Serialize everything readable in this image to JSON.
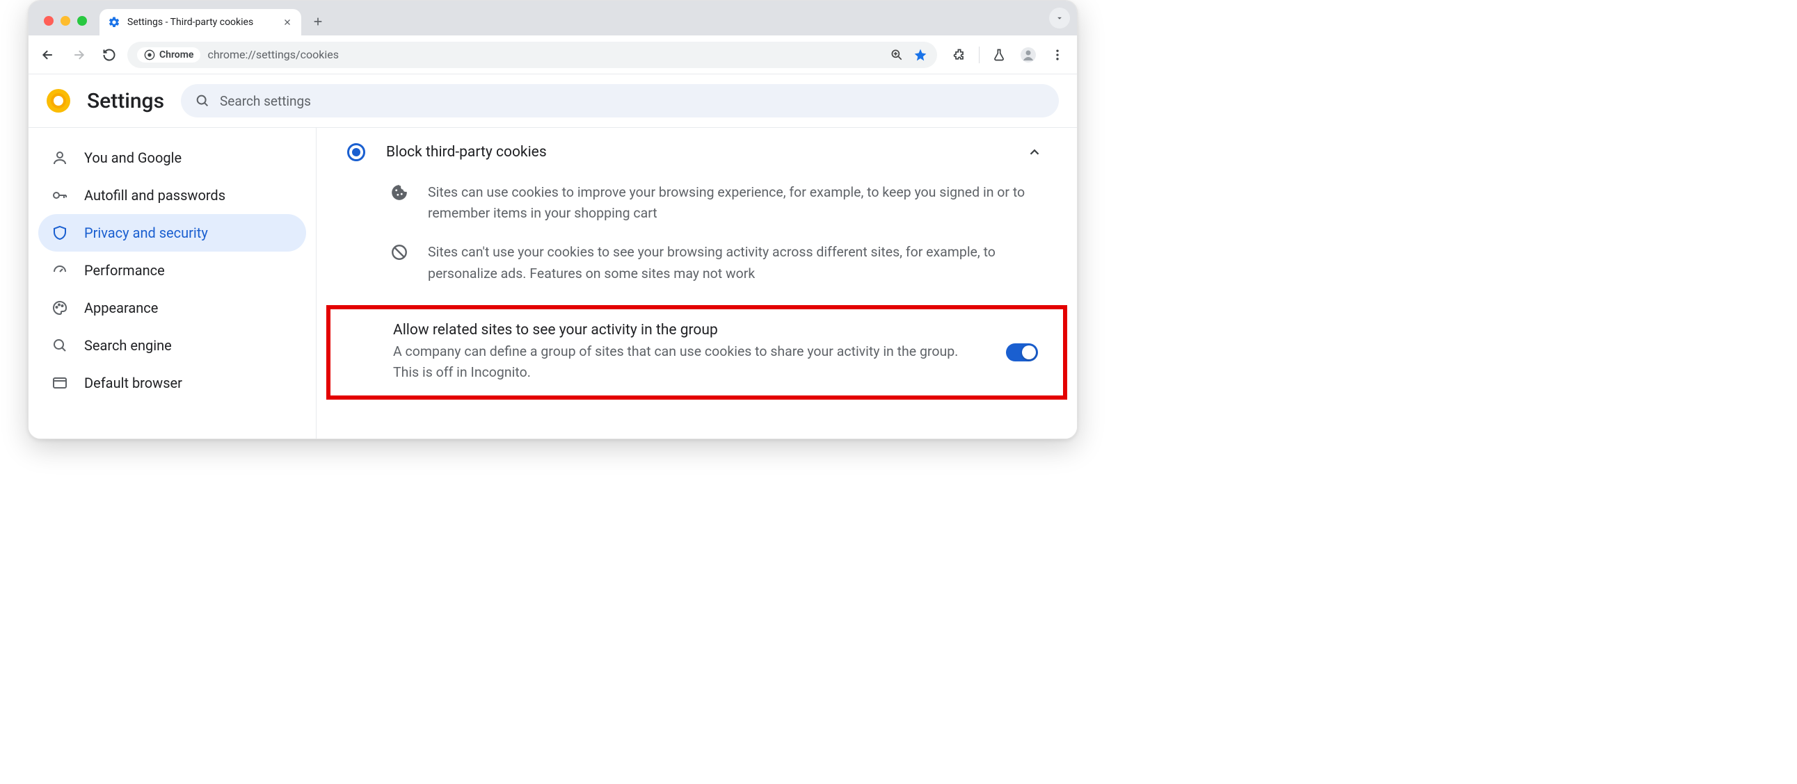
{
  "tab": {
    "title": "Settings - Third-party cookies"
  },
  "omnibox": {
    "chip_label": "Chrome",
    "url": "chrome://settings/cookies"
  },
  "header": {
    "title": "Settings"
  },
  "search": {
    "placeholder": "Search settings"
  },
  "sidebar": {
    "items": [
      {
        "label": "You and Google"
      },
      {
        "label": "Autofill and passwords"
      },
      {
        "label": "Privacy and security"
      },
      {
        "label": "Performance"
      },
      {
        "label": "Appearance"
      },
      {
        "label": "Search engine"
      },
      {
        "label": "Default browser"
      }
    ]
  },
  "main": {
    "radio_label": "Block third-party cookies",
    "desc1": "Sites can use cookies to improve your browsing experience, for example, to keep you signed in or to remember items in your shopping cart",
    "desc2": "Sites can't use your cookies to see your browsing activity across different sites, for example, to personalize ads. Features on some sites may not work",
    "related_title": "Allow related sites to see your activity in the group",
    "related_desc": "A company can define a group of sites that can use cookies to share your activity in the group. This is off in Incognito."
  }
}
